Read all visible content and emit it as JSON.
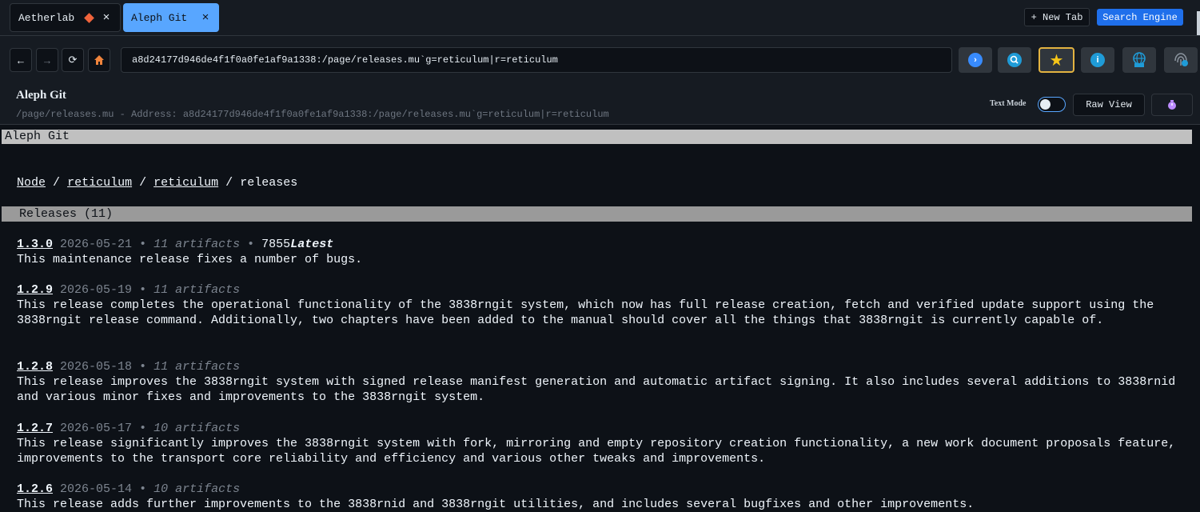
{
  "tabs": [
    {
      "label": "Aetherlab",
      "close": "×"
    },
    {
      "label": "Aleph Git",
      "close": "×"
    }
  ],
  "top_actions": {
    "new_tab": "+ New Tab",
    "search_engine": "Search Engine"
  },
  "nav": {
    "back": "←",
    "forward": "→",
    "reload": "⟳",
    "url": "a8d24177d946de4f1f0a0fe1af9a1338:/page/releases.mu`g=reticulum|r=reticulum"
  },
  "page_header": {
    "title": "Aleph Git",
    "subtitle": "/page/releases.mu - Address: a8d24177d946de4f1f0a0fe1af9a1338:/page/releases.mu`g=reticulum|r=reticulum",
    "text_mode_label": "Text Mode",
    "raw_view": "Raw View"
  },
  "content": {
    "title_bar": "Aleph Git",
    "breadcrumb": {
      "node": "Node",
      "sep": "/",
      "group": "reticulum",
      "repo": "reticulum",
      "current": "releases"
    },
    "releases_header": "Releases (11)",
    "releases": [
      {
        "version": "1.3.0",
        "date": "2026-05-21",
        "artifacts": "11 artifacts",
        "number": "7855",
        "latest": "Latest",
        "description": "This maintenance release fixes a number of bugs."
      },
      {
        "version": "1.2.9",
        "date": "2026-05-19",
        "artifacts": "11 artifacts",
        "description": "This release completes the operational functionality of the 3838rngit system, which now has full release creation, fetch and verified update support using the 3838rngit release command. Additionally, two chapters have been added to the manual should cover all the things that 3838rngit is currently capable of."
      },
      {
        "version": "1.2.8",
        "date": "2026-05-18",
        "artifacts": "11 artifacts",
        "description": "This release improves the 3838rngit system with signed release manifest generation and automatic artifact signing. It also includes several additions to 3838rnid and various minor fixes and improvements to the 3838rngit system."
      },
      {
        "version": "1.2.7",
        "date": "2026-05-17",
        "artifacts": "10 artifacts",
        "description": "This release significantly improves the 3838rngit system with fork, mirroring and empty repository creation functionality, a new work document proposals feature, improvements to the transport core reliability and efficiency and various other tweaks and improvements."
      },
      {
        "version": "1.2.6",
        "date": "2026-05-14",
        "artifacts": "10 artifacts",
        "description": "This release adds further improvements to the 3838rnid and 3838rngit utilities, and includes several bugfixes and other improvements."
      }
    ]
  },
  "colors": {
    "accent": "#58a6ff",
    "background": "#0d1117",
    "title_bar": "#c0c0c0",
    "releases_bar": "#9a9a9a"
  }
}
